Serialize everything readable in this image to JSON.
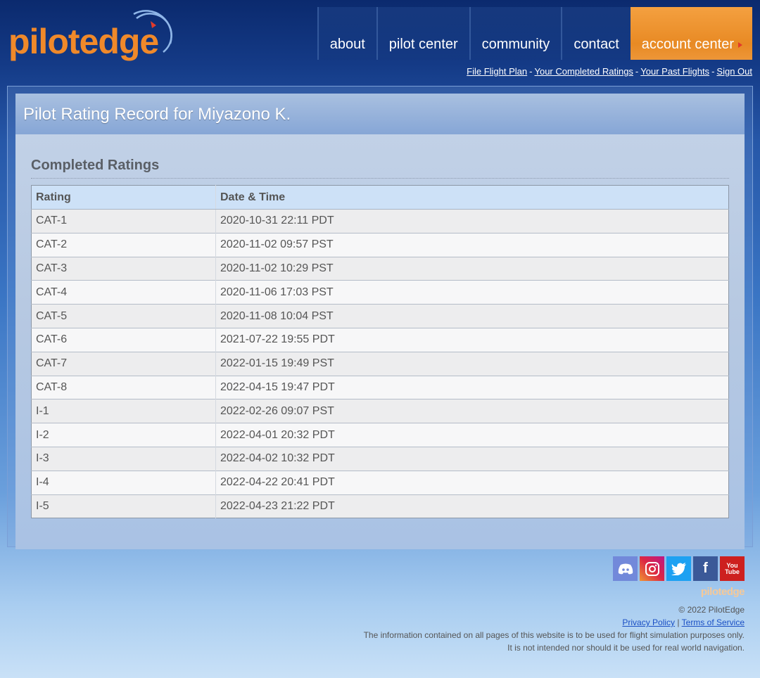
{
  "header": {
    "logo_text": "pilotedge",
    "nav": [
      "about",
      "pilot center",
      "community",
      "contact",
      "account center"
    ],
    "active_nav": "account center",
    "sublinks": [
      "File Flight Plan",
      "Your Completed Ratings",
      "Your Past Flights",
      "Sign Out"
    ]
  },
  "panel": {
    "title": "Pilot Rating Record for Miyazono K.",
    "section_title": "Completed Ratings"
  },
  "table": {
    "columns": [
      "Rating",
      "Date & Time"
    ],
    "rows": [
      [
        "CAT-1",
        "2020-10-31 22:11 PDT"
      ],
      [
        "CAT-2",
        "2020-11-02 09:57 PST"
      ],
      [
        "CAT-3",
        "2020-11-02 10:29 PST"
      ],
      [
        "CAT-4",
        "2020-11-06 17:03 PST"
      ],
      [
        "CAT-5",
        "2020-11-08 10:04 PST"
      ],
      [
        "CAT-6",
        "2021-07-22 19:55 PDT"
      ],
      [
        "CAT-7",
        "2022-01-15 19:49 PST"
      ],
      [
        "CAT-8",
        "2022-04-15 19:47 PDT"
      ],
      [
        "I-1",
        "2022-02-26 09:07 PST"
      ],
      [
        "I-2",
        "2022-04-01 20:32 PDT"
      ],
      [
        "I-3",
        "2022-04-02 10:32 PDT"
      ],
      [
        "I-4",
        "2022-04-22 20:41 PDT"
      ],
      [
        "I-5",
        "2022-04-23 21:22 PDT"
      ]
    ]
  },
  "footer": {
    "social_icons": [
      "discord-icon",
      "instagram-icon",
      "twitter-icon",
      "facebook-icon",
      "youtube-icon"
    ],
    "youtube_label_1": "You",
    "youtube_label_2": "Tube",
    "logo_text": "pilotedge",
    "copyright": "© 2022 PilotEdge",
    "privacy": "Privacy Policy",
    "terms": "Terms of Service",
    "disclaimer_1": "The information contained on all pages of this website is to be used for flight simulation purposes only.",
    "disclaimer_2": "It is not intended nor should it be used for real world navigation."
  },
  "colors": {
    "accent": "#ef922f",
    "header_bg": "#0b2a6e",
    "table_header": "#cde1f7"
  }
}
